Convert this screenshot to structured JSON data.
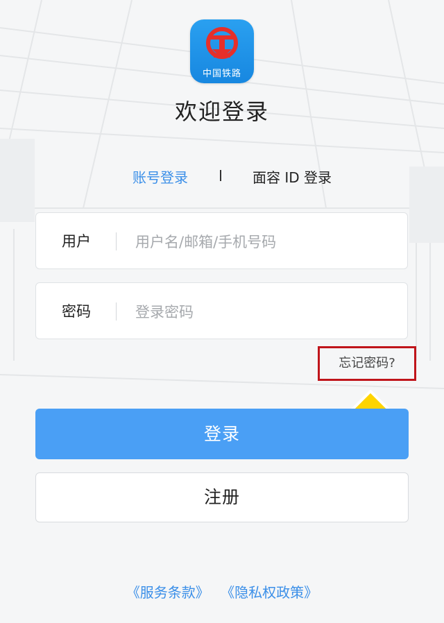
{
  "app": {
    "logo_text": "中国铁路",
    "title": "欢迎登录"
  },
  "tabs": {
    "account": "账号登录",
    "separator": "I",
    "face_id": "面容 ID 登录",
    "active": "account"
  },
  "form": {
    "user_label": "用户",
    "user_placeholder": "用户名/邮箱/手机号码",
    "user_value": "",
    "password_label": "密码",
    "password_placeholder": "登录密码",
    "password_value": ""
  },
  "forgot_password": "忘记密码?",
  "buttons": {
    "login": "登录",
    "register": "注册"
  },
  "links": {
    "terms": "《服务条款》",
    "privacy": "《隐私权政策》"
  },
  "colors": {
    "accent": "#3b8fe8",
    "login_button": "#4a9ff5",
    "highlight_box": "#c0151b",
    "arrow": "#ffd400"
  },
  "icons": {
    "logo": "china-railway-logo-icon",
    "annotation": "up-arrow-icon"
  }
}
